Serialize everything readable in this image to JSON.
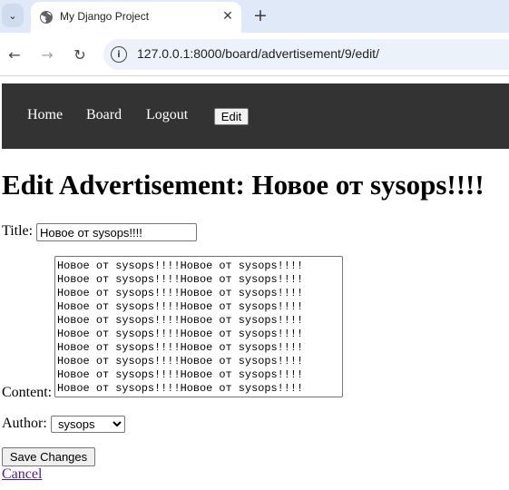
{
  "browser": {
    "tab_title": "My Django Project",
    "close_icon": "close-icon",
    "new_tab_icon": "plus-icon",
    "url": "127.0.0.1:8000/board/advertisement/9/edit/"
  },
  "nav": {
    "home": "Home",
    "board": "Board",
    "logout": "Logout",
    "edit": "Edit"
  },
  "page": {
    "heading": "Edit Advertisement: Новое от sysops!!!!"
  },
  "form": {
    "title_label": "Title:",
    "title_value": "Новое от sysops!!!!",
    "content_label": "Content:",
    "content_value": "Новое от sysops!!!!Новое от sysops!!!!\nНовое от sysops!!!!Новое от sysops!!!!\nНовое от sysops!!!!Новое от sysops!!!!\nНовое от sysops!!!!Новое от sysops!!!!\nНовое от sysops!!!!Новое от sysops!!!!\nНовое от sysops!!!!Новое от sysops!!!!\nНовое от sysops!!!!Новое от sysops!!!!\nНовое от sysops!!!!Новое от sysops!!!!\nНовое от sysops!!!!Новое от sysops!!!!\nНовое от sysops!!!!Новое от sysops!!!!",
    "author_label": "Author:",
    "author_selected": "sysops",
    "save_label": "Save Changes",
    "cancel_label": "Cancel"
  },
  "colors": {
    "nav_background": "#333333",
    "visited_link": "#551a8b",
    "tab_strip": "#dfe9f8"
  }
}
